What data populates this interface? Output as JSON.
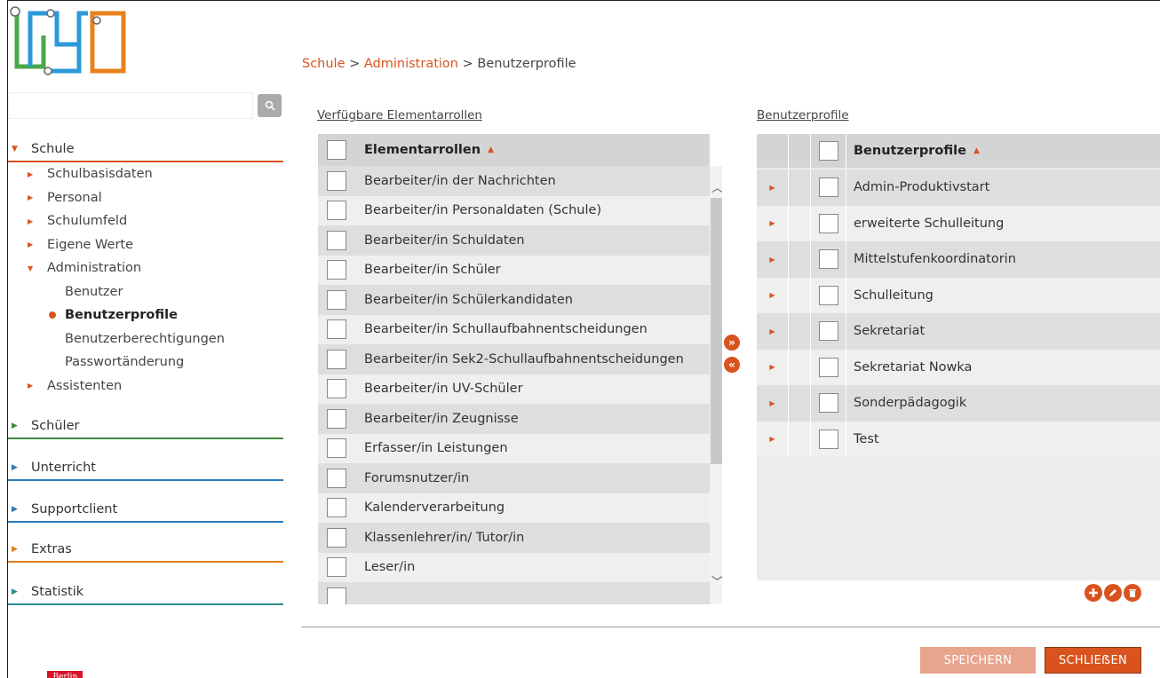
{
  "breadcrumb": {
    "part1": "Schule",
    "sep1": " > ",
    "part2": "Administration",
    "sep2": " > ",
    "current": "Benutzerprofile"
  },
  "search": {
    "placeholder": ""
  },
  "nav": {
    "schule": "Schule",
    "sub": [
      "Schulbasisdaten",
      "Personal",
      "Schulumfeld",
      "Eigene Werte",
      "Administration"
    ],
    "admin_items": [
      "Benutzer",
      "Benutzerprofile",
      "Benutzerberechtigungen",
      "Passwortänderung"
    ],
    "assistenten": "Assistenten",
    "sections": [
      {
        "label": "Schüler",
        "color": "#3d8b3d"
      },
      {
        "label": "Unterricht",
        "color": "#2a7ab8"
      },
      {
        "label": "Supportclient",
        "color": "#2a7ab8"
      },
      {
        "label": "Extras",
        "color": "#e07b1a"
      },
      {
        "label": "Statistik",
        "color": "#2a8a8a"
      }
    ]
  },
  "left_panel": {
    "title": "Verfügbare Elementarrollen",
    "header": "Elementarrollen",
    "rows": [
      "Bearbeiter/in der Nachrichten",
      "Bearbeiter/in Personaldaten (Schule)",
      "Bearbeiter/in Schuldaten",
      "Bearbeiter/in Schüler",
      "Bearbeiter/in Schülerkandidaten",
      "Bearbeiter/in Schullaufbahnentscheidungen",
      "Bearbeiter/in Sek2-Schullaufbahnentscheidungen",
      "Bearbeiter/in UV-Schüler",
      "Bearbeiter/in Zeugnisse",
      "Erfasser/in Leistungen",
      "Forumsnutzer/in",
      "Kalenderverarbeitung",
      "Klassenlehrer/in/ Tutor/in",
      "Leser/in",
      ""
    ]
  },
  "right_panel": {
    "title": "Benutzerprofile",
    "header": "Benutzerprofile",
    "rows": [
      "Admin-Produktivstart",
      "erweiterte Schulleitung",
      "Mittelstufenkoordinatorin",
      "Schulleitung",
      "Sekretariat",
      "Sekretariat Nowka",
      "Sonderpädagogik",
      "Test"
    ]
  },
  "buttons": {
    "save": "SPEICHERN",
    "close": "SCHLIEẞEN"
  },
  "footer_logo": {
    "text": "Berlin"
  },
  "colors": {
    "accent": "#d9531e",
    "save_bg": "#e8a48c",
    "close_bg": "#d9531e"
  }
}
